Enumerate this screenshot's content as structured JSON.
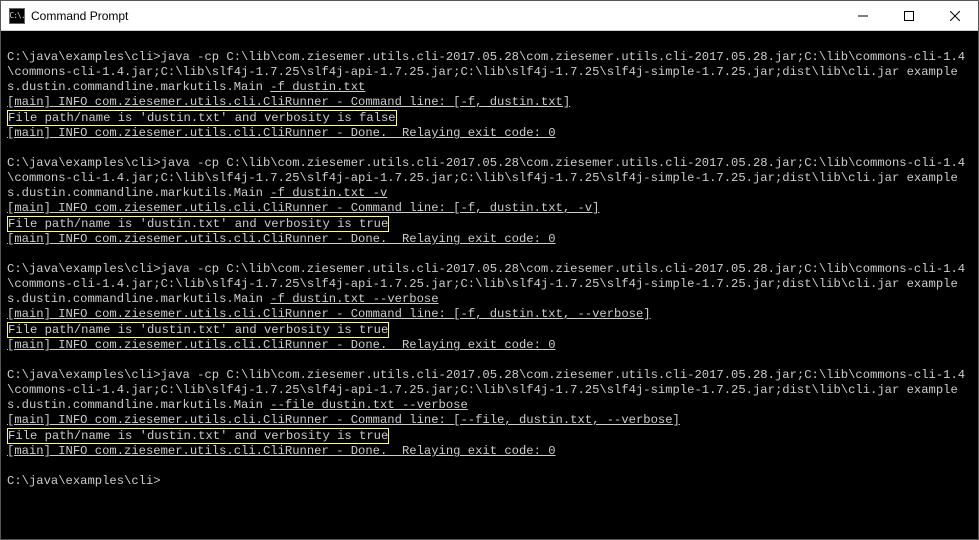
{
  "titlebar": {
    "icon_text": "C:\\.",
    "title": "Command Prompt"
  },
  "blocks": [
    {
      "cmd_prefix": "C:\\java\\examples\\cli>java -cp C:\\lib\\com.ziesemer.utils.cli-2017.05.28\\com.ziesemer.utils.cli-2017.05.28.jar;C:\\lib\\commons-cli-1.4\\commons-cli-1.4.jar;C:\\lib\\slf4j-1.7.25\\slf4j-api-1.7.25.jar;C:\\lib\\slf4j-1.7.25\\slf4j-simple-1.7.25.jar;dist\\lib\\cli.jar examples.dustin.commandline.markutils.Main ",
      "cmd_args": "-f dustin.txt",
      "info1_prefix": "[main] INFO com.ziesemer.utils.cli.CliRunner - Command line: ",
      "info1_args": "[-f, dustin.txt]",
      "result": "File path/name is 'dustin.txt' and verbosity is false",
      "info2": "[main] INFO com.ziesemer.utils.cli.CliRunner - Done.  Relaying exit code: 0"
    },
    {
      "cmd_prefix": "C:\\java\\examples\\cli>java -cp C:\\lib\\com.ziesemer.utils.cli-2017.05.28\\com.ziesemer.utils.cli-2017.05.28.jar;C:\\lib\\commons-cli-1.4\\commons-cli-1.4.jar;C:\\lib\\slf4j-1.7.25\\slf4j-api-1.7.25.jar;C:\\lib\\slf4j-1.7.25\\slf4j-simple-1.7.25.jar;dist\\lib\\cli.jar examples.dustin.commandline.markutils.Main ",
      "cmd_args": "-f dustin.txt -v",
      "info1_prefix": "[main] INFO com.ziesemer.utils.cli.CliRunner - Command line: ",
      "info1_args": "[-f, dustin.txt, -v]",
      "result": "File path/name is 'dustin.txt' and verbosity is true",
      "info2": "[main] INFO com.ziesemer.utils.cli.CliRunner - Done.  Relaying exit code: 0"
    },
    {
      "cmd_prefix": "C:\\java\\examples\\cli>java -cp C:\\lib\\com.ziesemer.utils.cli-2017.05.28\\com.ziesemer.utils.cli-2017.05.28.jar;C:\\lib\\commons-cli-1.4\\commons-cli-1.4.jar;C:\\lib\\slf4j-1.7.25\\slf4j-api-1.7.25.jar;C:\\lib\\slf4j-1.7.25\\slf4j-simple-1.7.25.jar;dist\\lib\\cli.jar examples.dustin.commandline.markutils.Main ",
      "cmd_args": "-f dustin.txt --verbose",
      "info1_prefix": "[main] INFO com.ziesemer.utils.cli.CliRunner - Command line: ",
      "info1_args": "[-f, dustin.txt, --verbose]",
      "result": "File path/name is 'dustin.txt' and verbosity is true",
      "info2": "[main] INFO com.ziesemer.utils.cli.CliRunner - Done.  Relaying exit code: 0"
    },
    {
      "cmd_prefix": "C:\\java\\examples\\cli>java -cp C:\\lib\\com.ziesemer.utils.cli-2017.05.28\\com.ziesemer.utils.cli-2017.05.28.jar;C:\\lib\\commons-cli-1.4\\commons-cli-1.4.jar;C:\\lib\\slf4j-1.7.25\\slf4j-api-1.7.25.jar;C:\\lib\\slf4j-1.7.25\\slf4j-simple-1.7.25.jar;dist\\lib\\cli.jar examples.dustin.commandline.markutils.Main ",
      "cmd_args": "--file dustin.txt --verbose",
      "info1_prefix": "[main] INFO com.ziesemer.utils.cli.CliRunner - Command line: ",
      "info1_args": "[--file, dustin.txt, --verbose]",
      "result": "File path/name is 'dustin.txt' and verbosity is true",
      "info2": "[main] INFO com.ziesemer.utils.cli.CliRunner - Done.  Relaying exit code: 0"
    }
  ],
  "prompt": "C:\\java\\examples\\cli>"
}
